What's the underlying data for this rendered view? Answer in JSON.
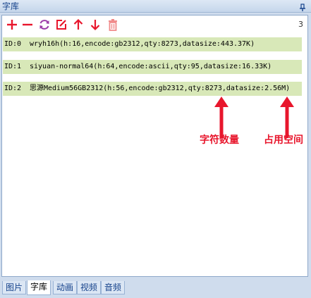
{
  "panel": {
    "title": "字库"
  },
  "toolbar": {
    "buttons": [
      "add-icon",
      "remove-icon",
      "refresh-icon",
      "edit-icon",
      "move-up-icon",
      "move-down-icon",
      "delete-icon"
    ],
    "count": "3",
    "colors": {
      "red": "#e8162c",
      "purple": "#9b3aa8"
    }
  },
  "fonts": [
    {
      "id": "ID:0",
      "desc": "wryh16h(h:16,encode:gb2312,qty:8273,datasize:443.37K)"
    },
    {
      "id": "ID:1",
      "desc": "siyuan-normal64(h:64,encode:ascii,qty:95,datasize:16.33K)"
    },
    {
      "id": "ID:2",
      "desc": "思源Medium56GB2312(h:56,encode:gb2312,qty:8273,datasize:2.56M)"
    }
  ],
  "annotations": {
    "qty": "字符数量",
    "size": "占用空间"
  },
  "tabs": [
    "图片",
    "字库",
    "动画",
    "视频",
    "音频"
  ],
  "active_tab": "字库"
}
